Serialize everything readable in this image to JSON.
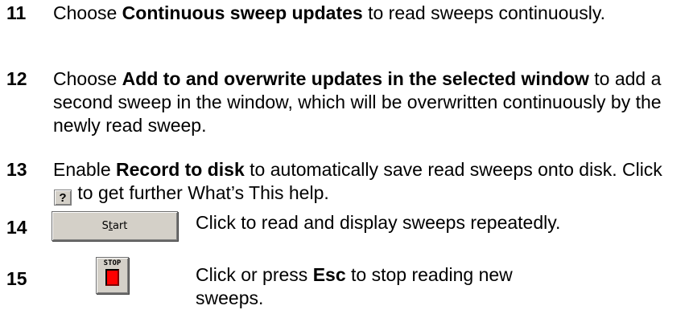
{
  "steps": [
    {
      "number": "11",
      "pre": "Choose ",
      "bold": "Continuous sweep updates",
      "post": " to read sweeps continuously."
    },
    {
      "number": "12",
      "pre": "Choose ",
      "bold": "Add to and overwrite updates in the selected window",
      "post": " to add a second sweep in the window, which will be overwritten continuously by the newly read sweep."
    },
    {
      "number": "13",
      "pre": "Enable ",
      "bold": "Record to disk",
      "post": " to automatically save read sweeps onto disk. Click ",
      "help_button": "?",
      "post2": " to get further What’s This help."
    },
    {
      "number": "14",
      "button": {
        "label_pre": "S",
        "label_underline": "t",
        "label_post": "art"
      },
      "text": "Click to read and display sweeps repeatedly."
    },
    {
      "number": "15",
      "button": {
        "label": "STOP"
      },
      "pre": "Click or press ",
      "bold": "Esc",
      "post": " to stop reading new sweeps."
    }
  ],
  "colors": {
    "text": "#000000",
    "button_face": "#d4d0c8",
    "stop_red": "#ff0000"
  },
  "icons": {
    "help": "question-mark-icon",
    "stop": "stop-icon"
  }
}
